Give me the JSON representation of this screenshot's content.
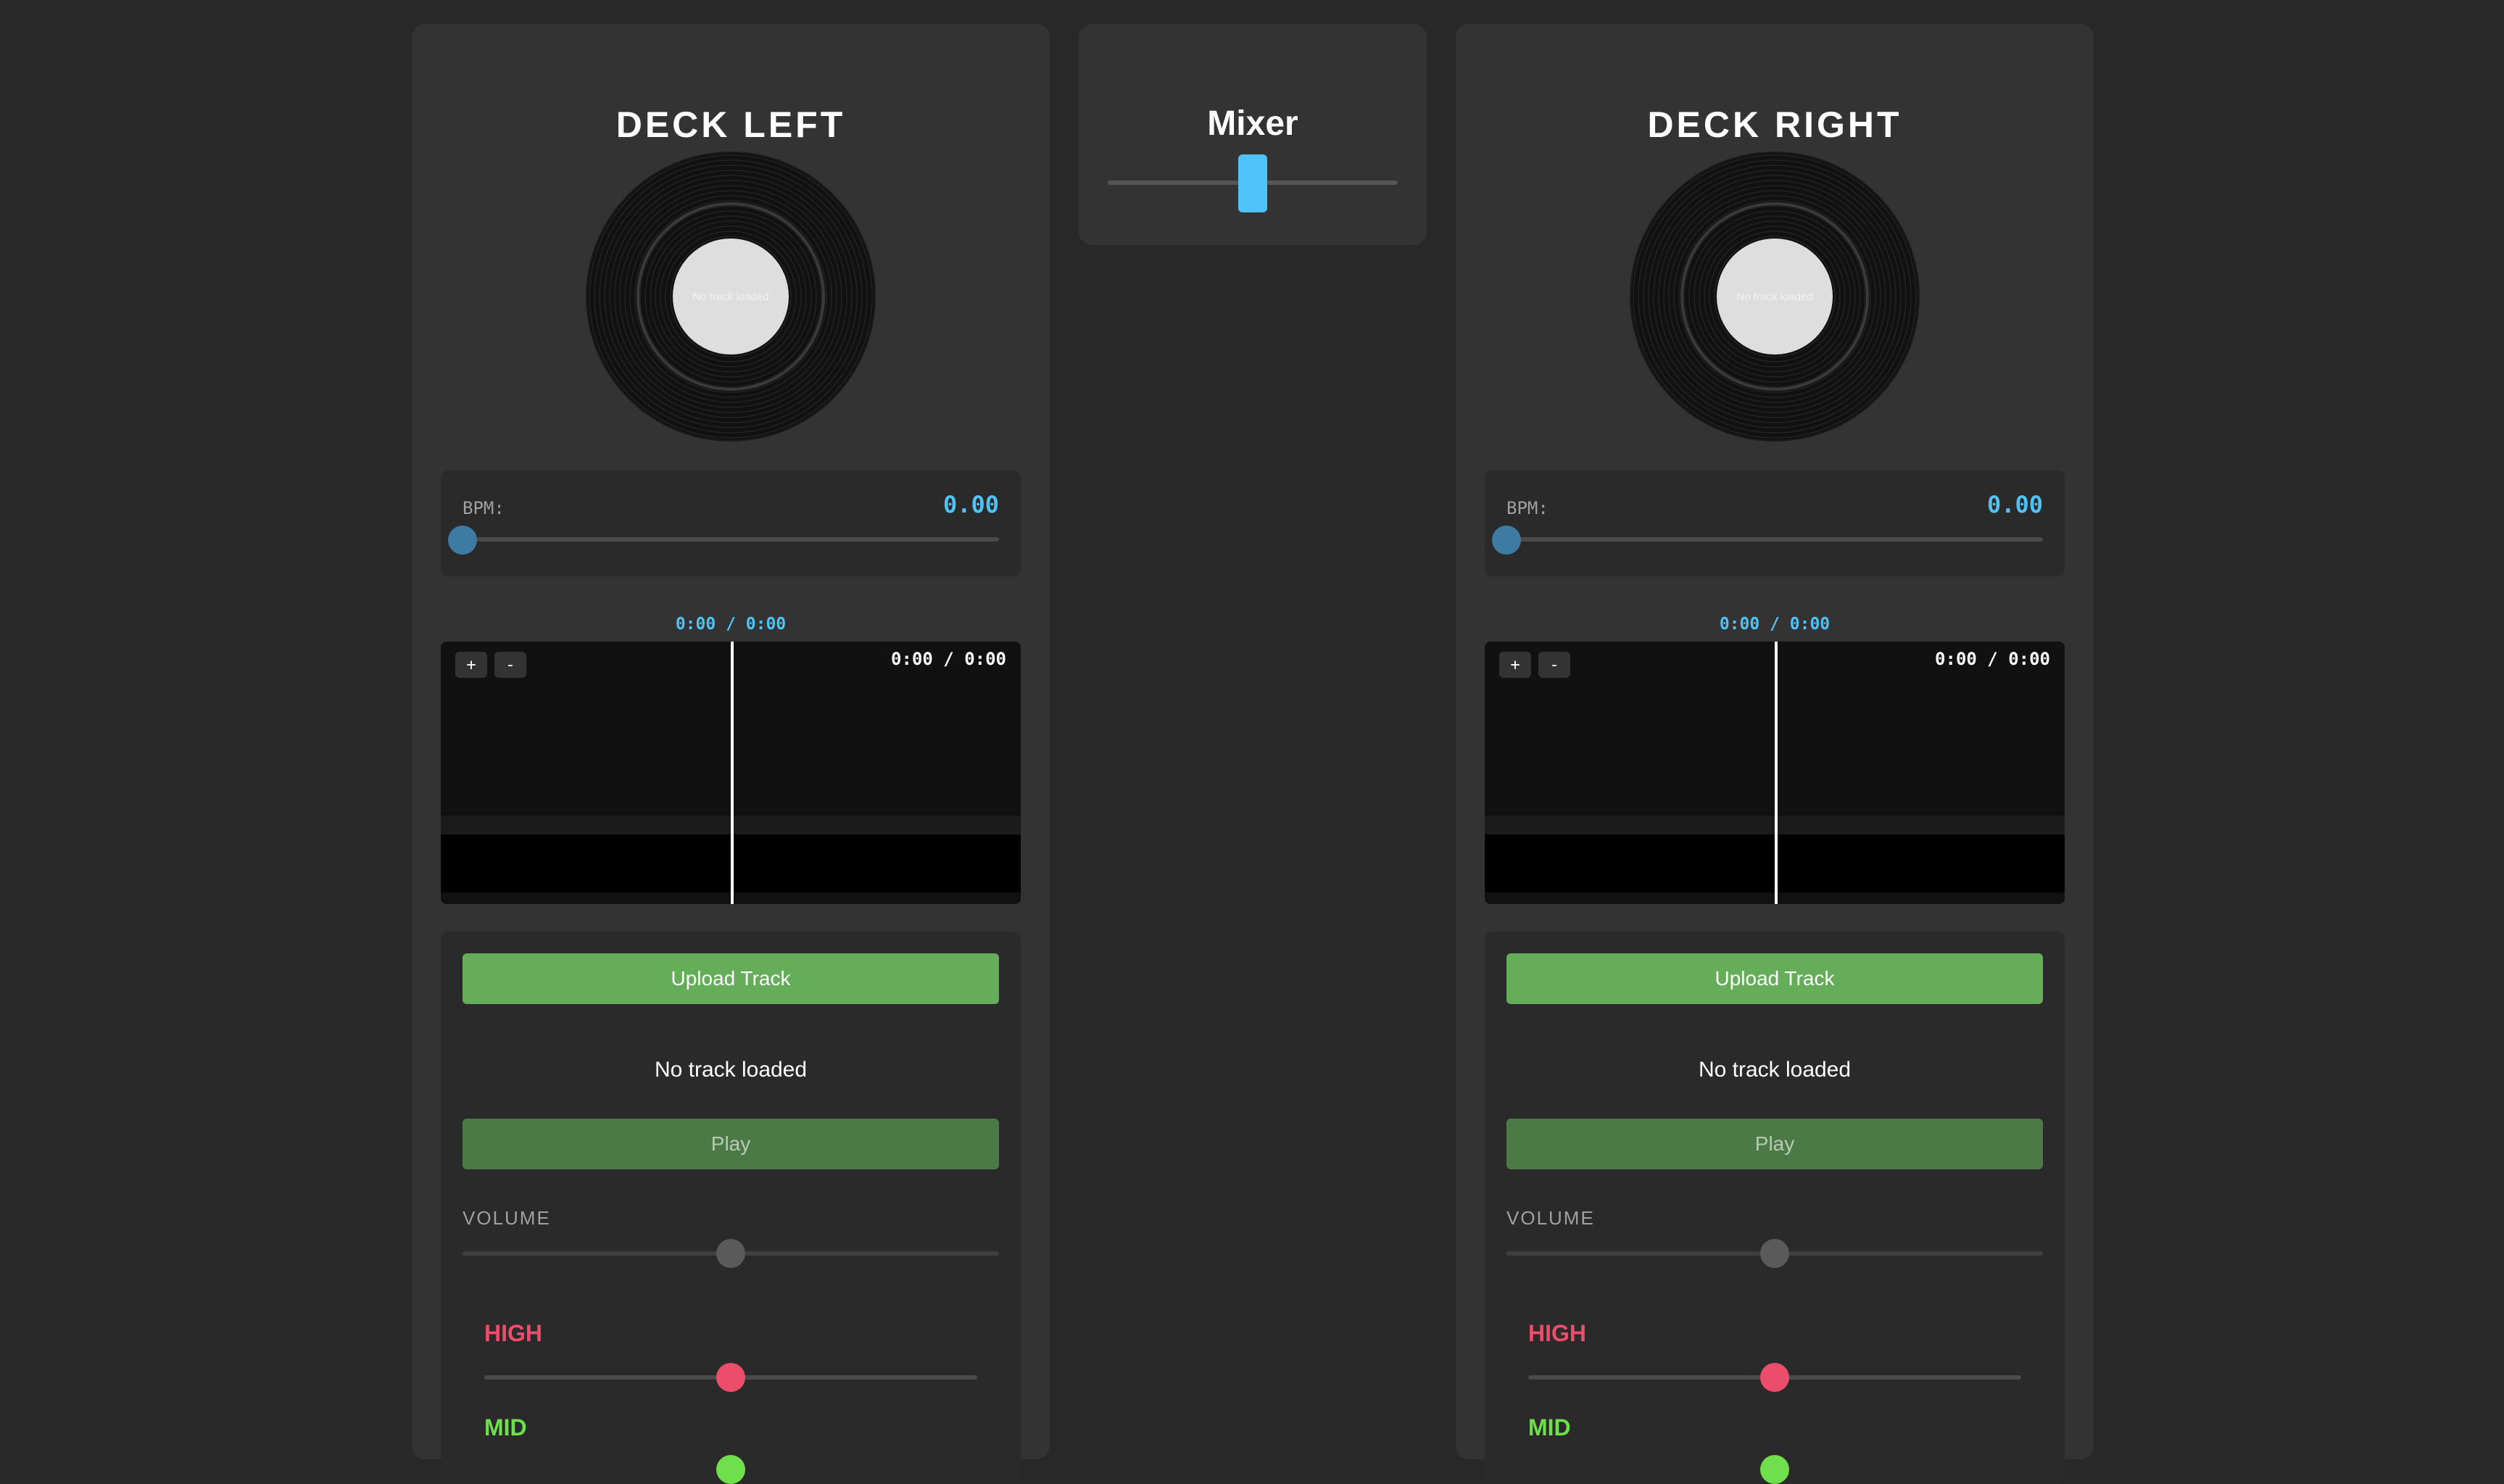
{
  "colors": {
    "background": "#282828",
    "panel": "#333333",
    "accent_blue": "#4fc3f7",
    "upload_green": "#66ad5a",
    "play_green": "#4b7a47",
    "eq_high": "#ec4d6b",
    "eq_mid": "#6fe04b"
  },
  "mixer": {
    "title": "Mixer",
    "crossfader_position": 0.5
  },
  "deck_left": {
    "title": "DECK LEFT",
    "vinyl_label": "No track loaded",
    "bpm_label": "BPM:",
    "bpm_value": "0.00",
    "time_readout": "0:00 / 0:00",
    "waveform": {
      "zoom_in": "+",
      "zoom_out": "-",
      "time": "0:00 / 0:00"
    },
    "upload_label": "Upload Track",
    "track_status": "No track loaded",
    "play_label": "Play",
    "volume_label": "VOLUME",
    "eq_high_label": "HIGH",
    "eq_mid_label": "MID"
  },
  "deck_right": {
    "title": "DECK RIGHT",
    "vinyl_label": "No track loaded",
    "bpm_label": "BPM:",
    "bpm_value": "0.00",
    "time_readout": "0:00 / 0:00",
    "waveform": {
      "zoom_in": "+",
      "zoom_out": "-",
      "time": "0:00 / 0:00"
    },
    "upload_label": "Upload Track",
    "track_status": "No track loaded",
    "play_label": "Play",
    "volume_label": "VOLUME",
    "eq_high_label": "HIGH",
    "eq_mid_label": "MID"
  }
}
